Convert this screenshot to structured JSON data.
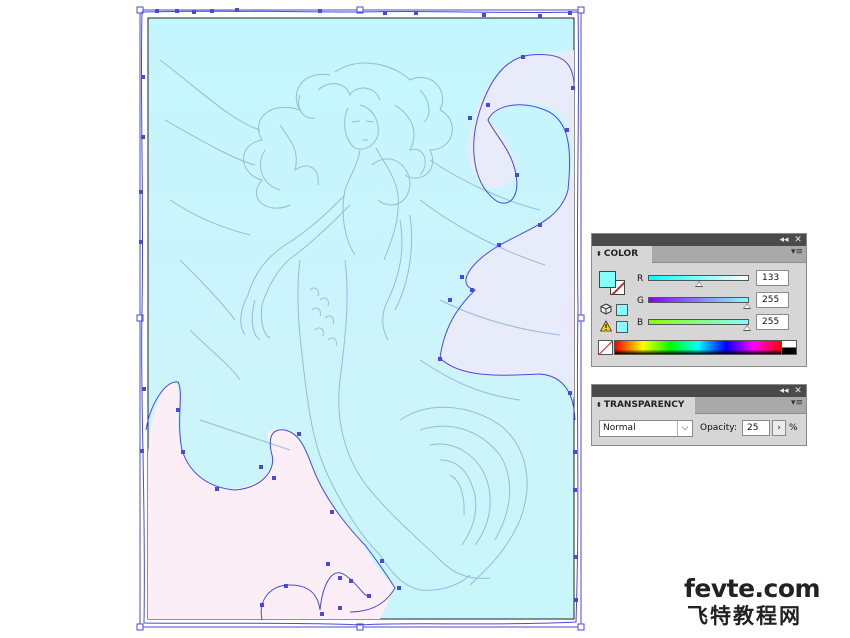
{
  "color_panel": {
    "tab_label": "COLOR",
    "fill_color": "#85ffff",
    "channels": [
      {
        "label": "R",
        "value": "133",
        "fraction": 0.52,
        "gradient": [
          "#00ffff",
          "#ffffff"
        ]
      },
      {
        "label": "G",
        "value": "255",
        "fraction": 1.0,
        "gradient": [
          "#8500ff",
          "#85ffff"
        ]
      },
      {
        "label": "B",
        "value": "255",
        "fraction": 1.0,
        "gradient": [
          "#85ff00",
          "#85ffff"
        ]
      }
    ],
    "icons": [
      "collapse-icon",
      "close-icon",
      "panel-menu-icon",
      "out-of-web-gamut-cube-icon",
      "out-of-gamut-warning-icon",
      "none-color-icon"
    ]
  },
  "transparency_panel": {
    "tab_label": "TRANSPARENCY",
    "blend_mode": "Normal",
    "opacity_label": "Opacity:",
    "opacity_value": "25",
    "opacity_unit": "%"
  },
  "artwork": {
    "background_top": "#c4f6ff",
    "background_bottom": "#fdeef6",
    "selection_color": "#4a4ad6",
    "sketch_color": "#8fb6d8"
  },
  "watermark": {
    "line1": "fevte.com",
    "line2": "飞特教程网"
  }
}
